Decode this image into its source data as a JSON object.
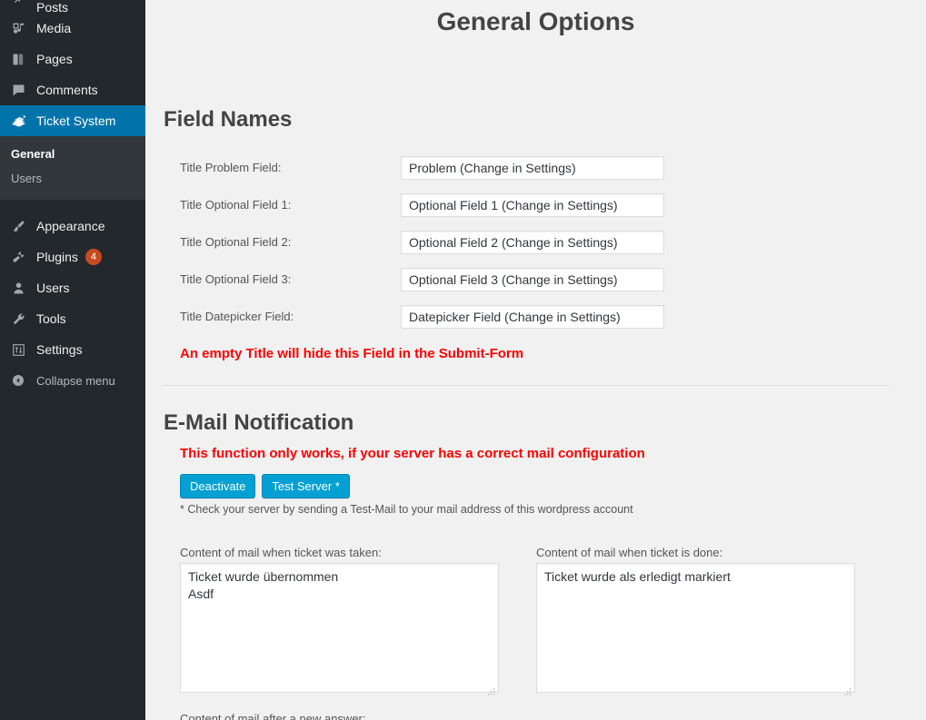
{
  "sidebar": {
    "items": [
      {
        "label": "Posts",
        "icon": "pin-icon",
        "badge": null,
        "current": false,
        "clipped": true
      },
      {
        "label": "Media",
        "icon": "media-icon",
        "badge": null,
        "current": false
      },
      {
        "label": "Pages",
        "icon": "pages-icon",
        "badge": null,
        "current": false
      },
      {
        "label": "Comments",
        "icon": "comments-icon",
        "badge": null,
        "current": false
      },
      {
        "label": "Ticket System",
        "icon": "ticket-icon",
        "badge": null,
        "current": true
      }
    ],
    "submenu": [
      {
        "label": "General",
        "current": true
      },
      {
        "label": "Users",
        "current": false
      }
    ],
    "items_after": [
      {
        "label": "Appearance",
        "icon": "brush-icon",
        "badge": null
      },
      {
        "label": "Plugins",
        "icon": "plugin-icon",
        "badge": "4"
      },
      {
        "label": "Users",
        "icon": "user-icon",
        "badge": null
      },
      {
        "label": "Tools",
        "icon": "wrench-icon",
        "badge": null
      },
      {
        "label": "Settings",
        "icon": "sliders-icon",
        "badge": null
      }
    ],
    "collapse": {
      "label": "Collapse menu",
      "icon": "collapse-arrow-icon"
    },
    "colors": {
      "bg": "#23282d",
      "submenu_bg": "#32373c",
      "current_bg": "#0073aa",
      "badge_bg": "#ca4a1f"
    }
  },
  "main": {
    "page_title": "General Options",
    "field_names": {
      "heading": "Field Names",
      "rows": [
        {
          "label": "Title Problem Field:",
          "value": "Problem (Change in Settings)"
        },
        {
          "label": "Title Optional Field 1:",
          "value": "Optional Field 1 (Change in Settings)"
        },
        {
          "label": "Title Optional Field 2:",
          "value": "Optional Field 2 (Change in Settings)"
        },
        {
          "label": "Title Optional Field 3:",
          "value": "Optional Field 3 (Change in Settings)"
        },
        {
          "label": "Title Datepicker Field:",
          "value": "Datepicker Field (Change in Settings)"
        }
      ],
      "note": "An empty Title will hide this Field in the Submit-Form",
      "note_color": "#ff0000"
    },
    "email_notification": {
      "heading": "E-Mail Notification",
      "note": "This function only works, if your server has a correct mail configuration",
      "note_color": "#ff0000",
      "buttons": [
        {
          "label": "Deactivate",
          "name": "deactivate-button"
        },
        {
          "label": "Test Server *",
          "name": "test-server-button"
        }
      ],
      "button_color": "#00a0d2",
      "footnote": "* Check your server by sending a Test-Mail to your mail address of this wordpress account",
      "textareas": [
        {
          "label": "Content of mail when ticket was taken:",
          "value": "Ticket wurde übernommen\nAsdf"
        },
        {
          "label": "Content of mail when ticket is done:",
          "value": "Ticket wurde als erledigt markiert"
        }
      ],
      "bottom_label": "Content of mail after a new answer:"
    }
  }
}
